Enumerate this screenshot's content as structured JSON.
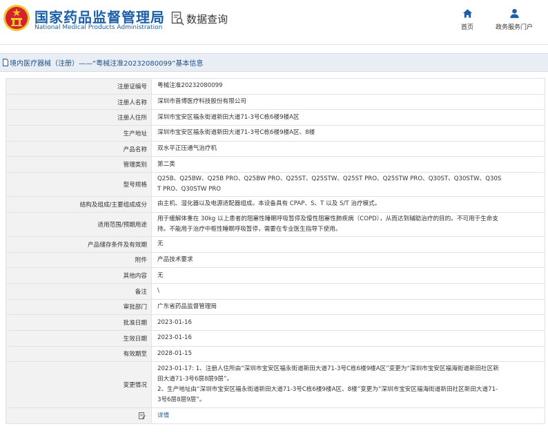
{
  "header": {
    "title": "国家药品监督管理局",
    "subtitle": "National Medical Products Administration",
    "query_title": "数据查询",
    "nav": [
      {
        "label": "首页",
        "icon": "home-icon"
      },
      {
        "label": "政务服务门户",
        "icon": "user-icon"
      }
    ]
  },
  "breadcrumb": {
    "text": "境内医疗器械（注册）——“粤械注准20232080099”基本信息"
  },
  "colors": {
    "brand": "#1b5fa8",
    "emblem_red": "#d2232a",
    "emblem_gold": "#f2c230",
    "label_bg": "#f2f2f2"
  },
  "record": {
    "rows": [
      {
        "label": "注册证编号",
        "value": "粤械注准20232080099"
      },
      {
        "label": "注册人名称",
        "value": "深圳市普博医疗科技股份有限公司"
      },
      {
        "label": "注册人住所",
        "value": "深圳市宝安区福永街道新田大道71-3号C栋6楼9楼A区"
      },
      {
        "label": "生产地址",
        "value": "深圳市宝安区福永街道新田大道71-3号C栋6楼9楼A区、8楼"
      },
      {
        "label": "产品名称",
        "value": "双水平正压通气治疗机"
      },
      {
        "label": "管理类别",
        "value": "第二类"
      },
      {
        "label": "型号规格",
        "lines": [
          "Q25B、Q25BW、Q25B PRO、Q25BW PRO、Q25ST、Q25STW、Q25ST PRO、Q25STW PRO、Q30ST、Q30STW、Q30S",
          "T PRO、Q30STW PRO"
        ]
      },
      {
        "label": "结构及组成/主要组成成分",
        "value": "由主机、湿化器以及电源适配器组成。本设备具有 CPAP、S、T 以及 S/T 治疗模式。"
      },
      {
        "label": "适用范围/预期用途",
        "lines": [
          "用于缓解体重在 30kg 以上患者的阻塞性睡眠呼吸暂停及慢性阻塞性肺疾病（COPD），从而达到辅助治疗的目的。不可用于生命支",
          "持。不能用于治疗中枢性睡眠呼吸暂停，需要在专业医生指导下使用。"
        ]
      },
      {
        "label": "产品储存条件及有效期",
        "value": "无"
      },
      {
        "label": "附件",
        "value": "产品技术要求"
      },
      {
        "label": "其他内容",
        "value": "无"
      },
      {
        "label": "备注",
        "value": "\\"
      },
      {
        "label": "审批部门",
        "value": "广东省药品监督管理局"
      },
      {
        "label": "批准日期",
        "value": "2023-01-16"
      },
      {
        "label": "生效日期",
        "value": "2023-01-16"
      },
      {
        "label": "有效期至",
        "value": "2028-01-15"
      },
      {
        "label": "变更情况",
        "lines": [
          "2023-01-17: 1、注册人住所由“深圳市宝安区福永街道新田大道71-3号C栋6楼9楼A区”变更为“深圳市宝安区福海街道新田社区新",
          "田大道71-3号6层8层9层”。",
          "2、生产地址由“深圳市宝安区福永街道新田大道71-3号C栋6楼9楼A区、8楼”变更为“深圳市宝安区福海街道新田社区新田大道71-",
          "3号6层8层9层”。"
        ]
      }
    ],
    "details_label": "详情"
  }
}
